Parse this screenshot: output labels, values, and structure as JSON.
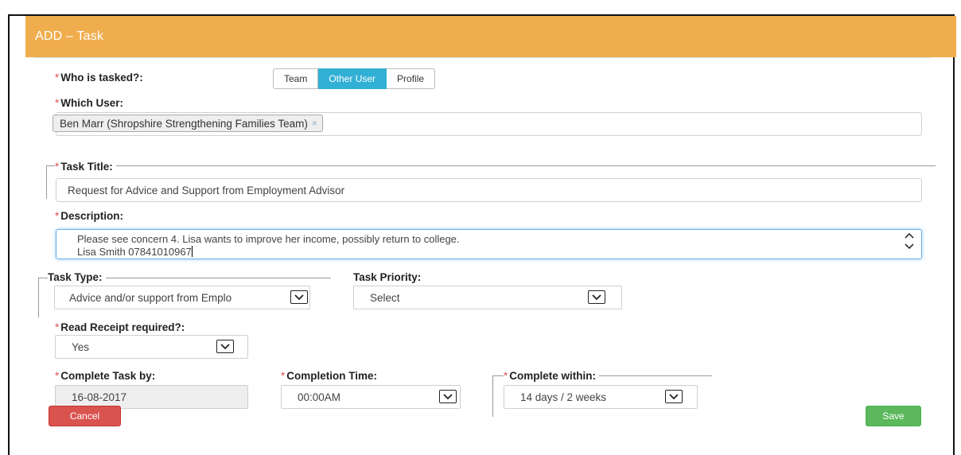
{
  "header": {
    "title": "ADD – Task"
  },
  "who_tasked": {
    "label": "Who is tasked?:",
    "options": [
      "Team",
      "Other User",
      "Profile"
    ],
    "selected": "Other User"
  },
  "which_user": {
    "label": "Which User:",
    "tag": "Ben Marr (Shropshire Strengthening Families Team)",
    "tag_remove": "×"
  },
  "task_title": {
    "label": "Task Title:",
    "value": "Request for Advice and Support from Employment Advisor"
  },
  "description": {
    "label": "Description:",
    "line1": "Please see concern 4.  Lisa wants to improve her income, possibly return to college.",
    "line2": "Lisa Smith 07841010967"
  },
  "task_type": {
    "label": "Task Type:",
    "value": "Advice and/or support from Emplo"
  },
  "task_priority": {
    "label": "Task Priority:",
    "value": "Select"
  },
  "read_receipt": {
    "label": "Read Receipt required?:",
    "value": "Yes"
  },
  "complete_by": {
    "label": "Complete Task by:",
    "value": "16-08-2017"
  },
  "completion_time": {
    "label": "Completion Time:",
    "value": "00:00AM"
  },
  "complete_within": {
    "label": "Complete within:",
    "value": "14 days / 2 weeks"
  },
  "required_marker": "*",
  "buttons": {
    "cancel": "Cancel",
    "save": "Save"
  },
  "colors": {
    "header_bg": "#f0ad4e",
    "active_segment": "#31b0d5",
    "required": "#d9534f",
    "cancel_button": "#d9534f",
    "save_button": "#5cb85c",
    "focus_border": "#66afe9"
  },
  "icons": {
    "dropdown": "chevron-down-icon",
    "scroll_up": "chevron-up-icon",
    "scroll_down": "chevron-down-icon",
    "tag_remove": "close-icon"
  }
}
